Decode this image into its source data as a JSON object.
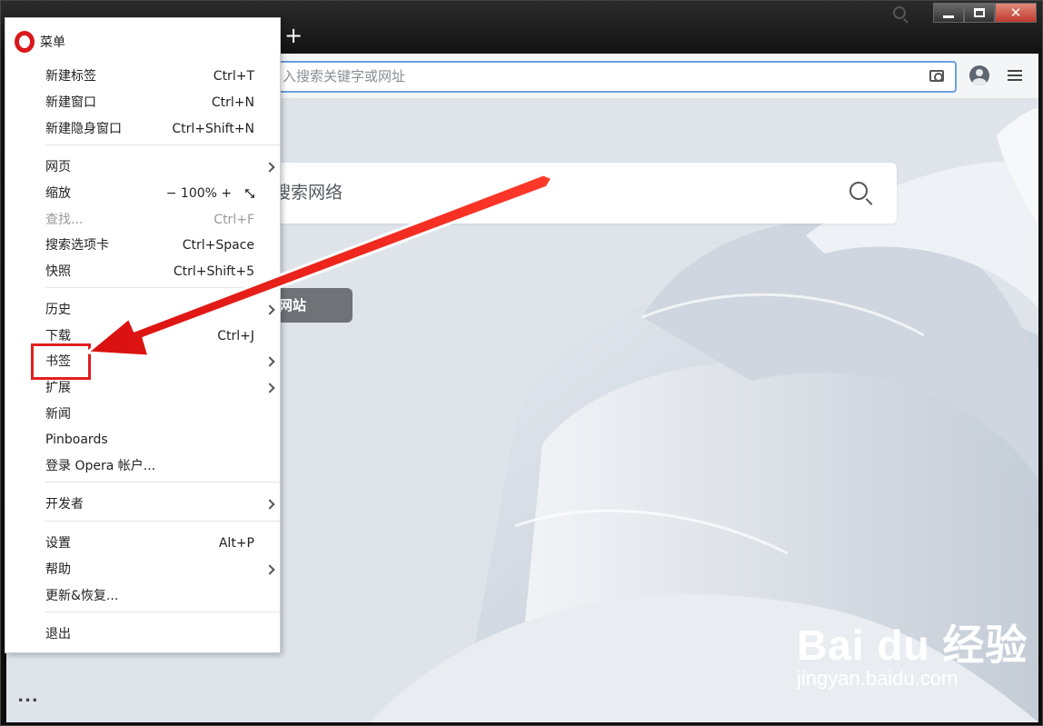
{
  "window": {
    "controls": [
      "minimize",
      "maximize",
      "close"
    ],
    "new_tab_label": "+"
  },
  "toolbar": {
    "address_placeholder": "入搜索关键字或网址"
  },
  "content": {
    "search_placeholder": "搜索网络",
    "pill_label": "网站",
    "watermark": {
      "main": "Bai du 经验",
      "sub": "jingyan.baidu.com"
    }
  },
  "sidebar": {
    "more_label": "..."
  },
  "menu": {
    "title": "菜单",
    "groups": [
      {
        "items": [
          {
            "label": "新建标签",
            "shortcut": "Ctrl+T"
          },
          {
            "label": "新建窗口",
            "shortcut": "Ctrl+N"
          },
          {
            "label": "新建隐身窗口",
            "shortcut": "Ctrl+Shift+N"
          }
        ]
      },
      {
        "items": [
          {
            "label": "网页",
            "submenu": true
          },
          {
            "label": "缩放",
            "zoom": {
              "minus": "−",
              "value": "100%",
              "plus": "+",
              "fullscreen": "⤡"
            }
          },
          {
            "label": "查找...",
            "shortcut": "Ctrl+F",
            "disabled": true
          },
          {
            "label": "搜索选项卡",
            "shortcut": "Ctrl+Space"
          },
          {
            "label": "快照",
            "shortcut": "Ctrl+Shift+5"
          }
        ]
      },
      {
        "items": [
          {
            "label": "历史",
            "submenu": true
          },
          {
            "label": "下载",
            "shortcut": "Ctrl+J"
          },
          {
            "label": "书签",
            "submenu": true,
            "highlighted": true
          },
          {
            "label": "扩展",
            "submenu": true
          },
          {
            "label": "新闻"
          },
          {
            "label": "Pinboards"
          },
          {
            "label": "登录 Opera 帐户..."
          }
        ]
      },
      {
        "items": [
          {
            "label": "开发者",
            "submenu": true
          }
        ]
      },
      {
        "items": [
          {
            "label": "设置",
            "shortcut": "Alt+P"
          },
          {
            "label": "帮助",
            "submenu": true
          },
          {
            "label": "更新&恢复..."
          }
        ]
      },
      {
        "items": [
          {
            "label": "退出"
          }
        ]
      }
    ]
  },
  "colors": {
    "accent_red": "#e02020",
    "opera_red": "#d9181c",
    "address_focus": "#6aa0e0"
  }
}
